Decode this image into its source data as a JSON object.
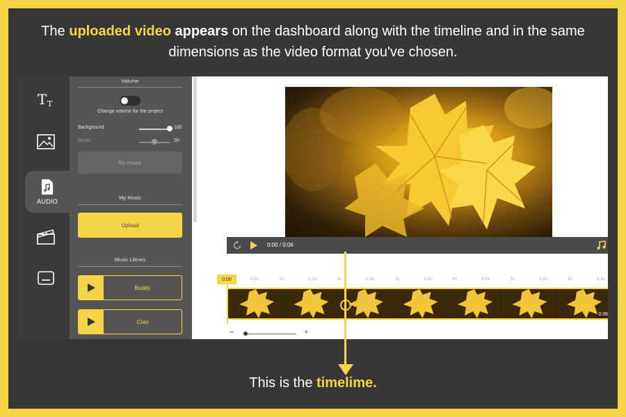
{
  "caption": {
    "part1": "The ",
    "highlight1": "uploaded video",
    "part2": " ",
    "bold1": "appears",
    "part3": " on the dashboard along with the timeline and in the same dimensions as the video format you've chosen."
  },
  "bottom_caption": {
    "part1": "This is the ",
    "highlight": "timelime."
  },
  "sidebar": {
    "items": [
      {
        "icon": "text-icon",
        "label": ""
      },
      {
        "icon": "image-icon",
        "label": ""
      },
      {
        "icon": "audio-file-icon",
        "label": "AUDIO"
      },
      {
        "icon": "clapperboard-icon",
        "label": ""
      },
      {
        "icon": "subtitles-icon",
        "label": ""
      }
    ]
  },
  "panel": {
    "volume_title": "Volume",
    "change_volume_label": "Change volume for the project",
    "background_label": "Background",
    "background_value": "100",
    "background_level": 1.0,
    "music_label": "Music",
    "music_value": "50",
    "music_level": 0.5,
    "no_music_label": "No music",
    "my_music_title": "My Music",
    "upload_label": "Upload",
    "library_title": "Music Library",
    "tracks": [
      "Buddy",
      "Cute"
    ]
  },
  "player": {
    "time_display": "0:00 / 0:06"
  },
  "timeline": {
    "current_time": "0:00",
    "ticks": [
      "0.5s",
      "1s",
      "1.5s",
      "2s",
      "2.5s",
      "3s",
      "3.5s",
      "4s",
      "4.5s",
      "5s",
      "5.5s",
      "6s",
      "6.5s"
    ],
    "duration": "0:06",
    "zoom_out": "−",
    "zoom_in": "+"
  },
  "colors": {
    "accent": "#f5d547",
    "background": "#373737",
    "panel": "#555555"
  }
}
